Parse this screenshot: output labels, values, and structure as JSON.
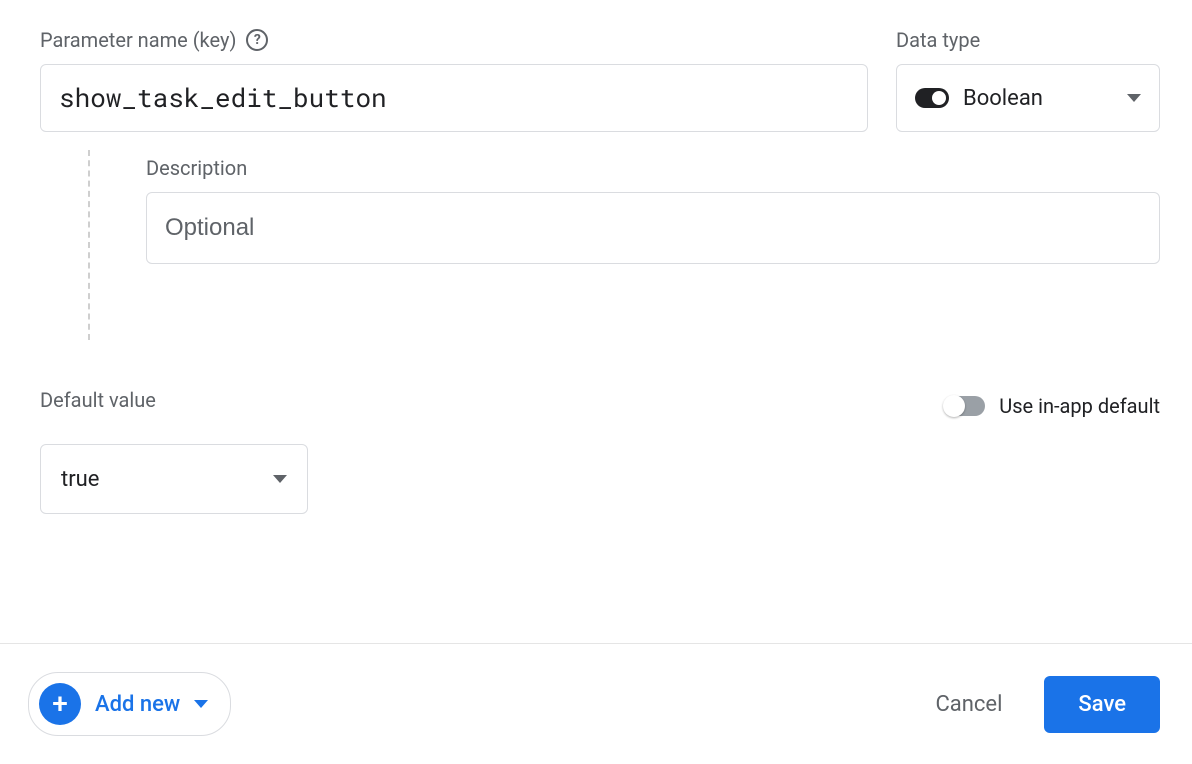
{
  "labels": {
    "parameter_name": "Parameter name (key)",
    "data_type": "Data type",
    "description": "Description",
    "default_value": "Default value",
    "use_inapp_default": "Use in-app default"
  },
  "fields": {
    "parameter_name_value": "show_task_edit_button",
    "data_type_selected": "Boolean",
    "description_value": "",
    "description_placeholder": "Optional",
    "default_value_selected": "true",
    "use_inapp_default_on": false
  },
  "footer": {
    "add_new_label": "Add new",
    "cancel_label": "Cancel",
    "save_label": "Save"
  }
}
